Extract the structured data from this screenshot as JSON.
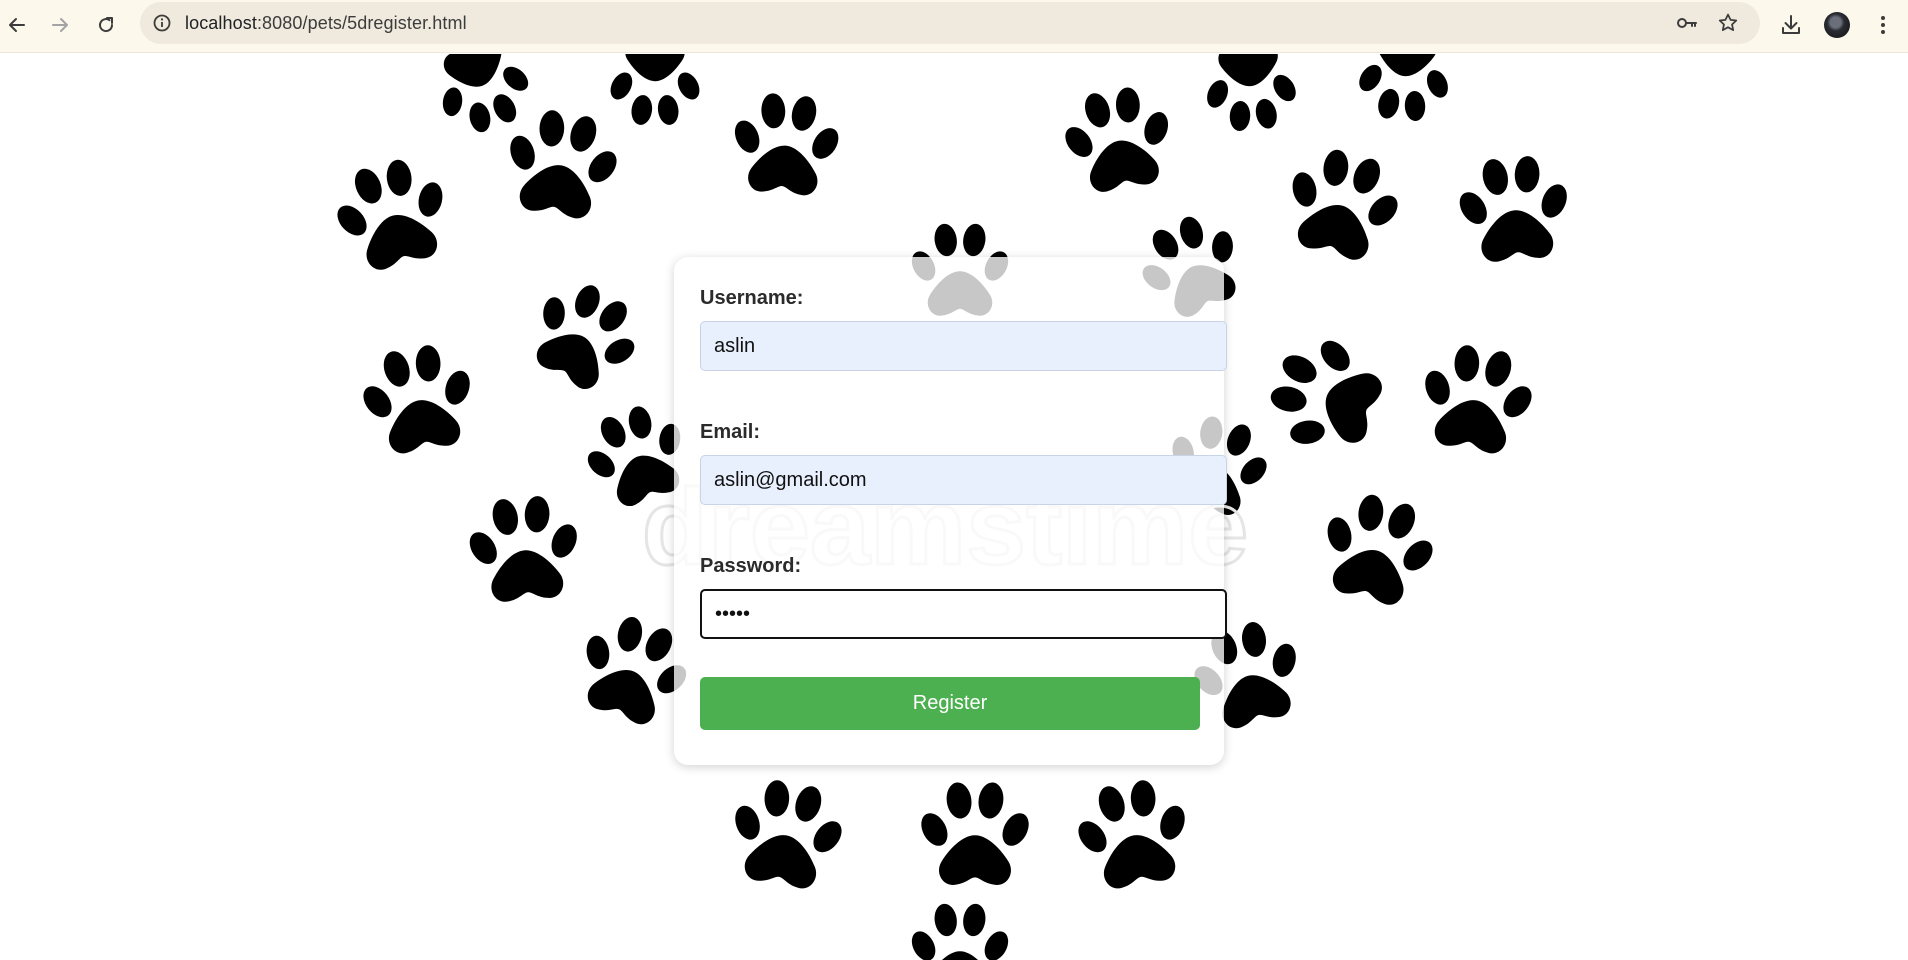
{
  "browser": {
    "url_host": "localhost",
    "url_rest": ":8080/pets/5dregister.html"
  },
  "form": {
    "username_label": "Username:",
    "username_value": "aslin",
    "email_label": "Email:",
    "email_value": "aslin@gmail.com",
    "password_label": "Password:",
    "password_value": "•••••",
    "register_label": "Register"
  },
  "background": {
    "watermark_text": "dreamstime"
  },
  "colors": {
    "button": "#4caf50",
    "autofill_bg": "#e8f0fe",
    "paw": "#000000"
  }
}
